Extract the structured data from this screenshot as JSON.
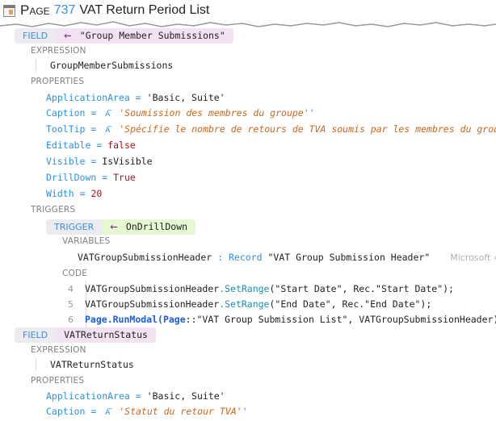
{
  "header": {
    "object_type": "Page",
    "object_id": "737",
    "object_name": "VAT Return Period List",
    "icon": "page-icon"
  },
  "fields": [
    {
      "keyword": "FIELD",
      "arrow": "←",
      "name": "\"Group Member Submissions\"",
      "expression_label": "EXPRESSION",
      "expression": "GroupMemberSubmissions",
      "properties_label": "PROPERTIES",
      "properties": {
        "application_area": {
          "name": "ApplicationArea",
          "eq": "=",
          "value": "'Basic, Suite'"
        },
        "caption": {
          "name": "Caption",
          "eq": "=",
          "icon": "translation-icon",
          "value": "'Soumission des membres du groupe'"
        },
        "tooltip": {
          "name": "ToolTip",
          "eq": "=",
          "icon": "translation-icon",
          "value": "'Spécifie le nombre de retours de TVA soumis par les membres du groupe"
        },
        "editable": {
          "name": "Editable",
          "eq": "=",
          "value": "false"
        },
        "visible": {
          "name": "Visible",
          "eq": "=",
          "value": "IsVisible"
        },
        "drilldown": {
          "name": "DrillDown",
          "eq": "=",
          "value": "True"
        },
        "width": {
          "name": "Width",
          "eq": "=",
          "value": "20"
        }
      },
      "triggers_label": "TRIGGERS",
      "trigger": {
        "keyword": "TRIGGER",
        "arrow": "←",
        "name": "OnDrillDown",
        "variables_label": "VARIABLES",
        "variable": {
          "name": "VATGroupSubmissionHeader",
          "colon": ":",
          "type": "Record",
          "type_arg": "\"VAT Group Submission Header\"",
          "breadcrumb": "Microsoft › VAT"
        },
        "code_label": "CODE",
        "code_lines": [
          {
            "num": "4",
            "obj": "VATGroupSubmissionHeader",
            "method": ".SetRange",
            "args": "(\"Start Date\", Rec.\"Start Date\");"
          },
          {
            "num": "5",
            "obj": "VATGroupSubmissionHeader",
            "method": ".SetRange",
            "args": "(\"End Date\", Rec.\"End Date\");"
          },
          {
            "num": "6",
            "obj": "Page",
            "method": ".RunModal",
            "kw2": "(Page",
            "args": "::\"VAT Group Submission List\", VATGroupSubmissionHeader);"
          }
        ]
      }
    },
    {
      "keyword": "FIELD",
      "name": "VATReturnStatus",
      "expression_label": "EXPRESSION",
      "expression": "VATReturnStatus",
      "properties_label": "PROPERTIES",
      "properties": {
        "application_area": {
          "name": "ApplicationArea",
          "eq": "=",
          "value": "'Basic, Suite'"
        },
        "caption": {
          "name": "Caption",
          "eq": "=",
          "icon": "translation-icon",
          "value": "'Statut du retour TVA'"
        }
      }
    }
  ]
}
